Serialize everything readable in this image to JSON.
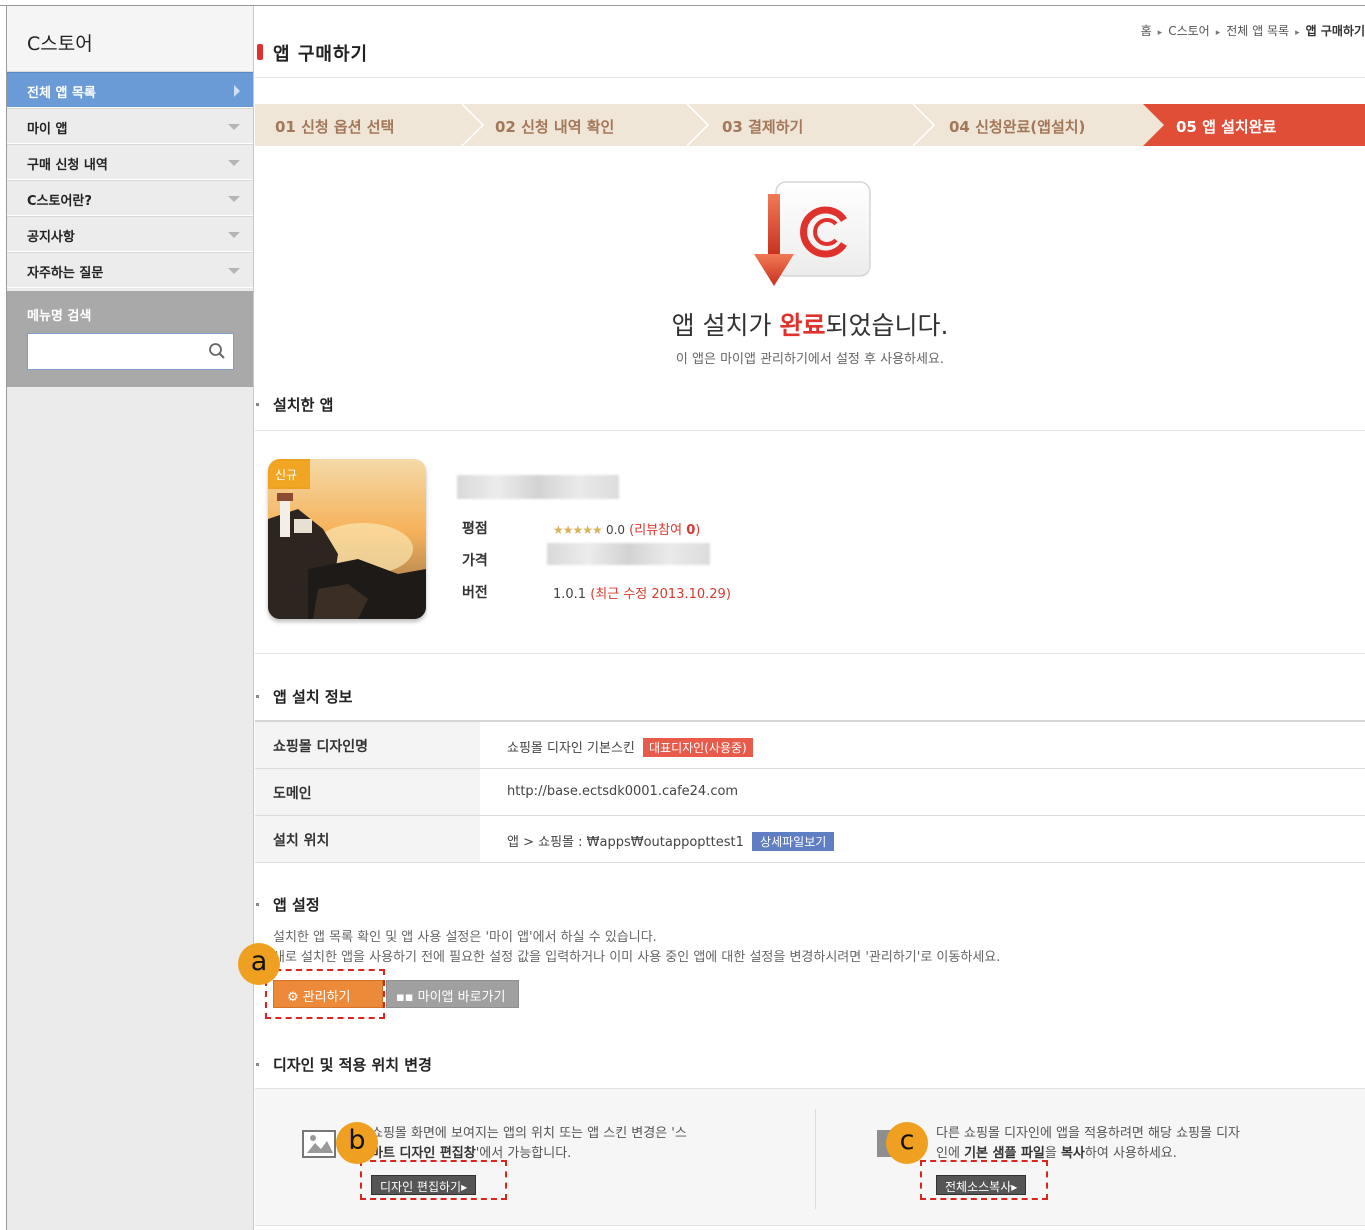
{
  "sidebar": {
    "title": "C스토어",
    "items": [
      {
        "label": "전체 앱 목록"
      },
      {
        "label": "마이 앱"
      },
      {
        "label": "구매 신청 내역"
      },
      {
        "label": "C스토어란?"
      },
      {
        "label": "공지사항"
      },
      {
        "label": "자주하는 질문"
      }
    ],
    "search_label": "메뉴명 검색",
    "search_value": ""
  },
  "header": {
    "title": "앱 구매하기",
    "breadcrumb": [
      "홈",
      "C스토어",
      "전체 앱 목록",
      "앱 구매하기"
    ]
  },
  "steps": [
    {
      "label": "01 신청 옵션 선택"
    },
    {
      "label": "02 신청 내역 확인"
    },
    {
      "label": "03 결제하기"
    },
    {
      "label": "04 신청완료(앱설치)"
    },
    {
      "label": "05 앱 설치완료"
    }
  ],
  "complete": {
    "title_pre": "앱 설치가 ",
    "title_hl": "완료",
    "title_post": "되었습니다.",
    "subtitle": "이 앱은 마이앱 관리하기에서 설정 후 사용하세요."
  },
  "installed_app": {
    "section_title": "설치한 앱",
    "new_badge": "신규",
    "rating_label": "평점",
    "stars": "★★★★★",
    "rating_value": "0.0",
    "review_text": "(리뷰참여 ",
    "review_count": "0",
    "review_close": ")",
    "price_label": "가격",
    "version_label": "버전",
    "version": "1.0.1",
    "updated": "(최근 수정 2013.10.29)"
  },
  "install_info": {
    "section_title": "앱 설치 정보",
    "rows": [
      {
        "label": "쇼핑몰 디자인명",
        "value": "쇼핑몰 디자인 기본스킨",
        "tag": "대표디자인(사용중)"
      },
      {
        "label": "도메인",
        "value": "http://base.ectsdk0001.cafe24.com"
      },
      {
        "label": "설치 위치",
        "value": "앱 > 쇼핑몰 :  ₩apps₩outappopttest1",
        "tag": "상세파일보기"
      }
    ]
  },
  "app_settings": {
    "section_title": "앱 설정",
    "desc1": "설치한 앱 목록 확인 및 앱 사용 설정은 '마이 앱'에서 하실 수 있습니다.",
    "desc2": "새로 설치한 앱을 사용하기 전에 필요한 설정 값을 입력하거나 이미 사용 중인 앱에 대한 설정을 변경하시려면 '관리하기'로 이동하세요.",
    "manage_button": "관리하기",
    "myapp_button": "마이앱 바로가기"
  },
  "design_change": {
    "section_title": "디자인 및 적용 위치 변경",
    "left_text1": "쇼핑몰 화면에 보여지는 앱의 위치 또는 앱 스킨 변경은 '스",
    "left_text2_bold": "마트 디자인 편집창",
    "left_text2_rest": "'에서 가능합니다.",
    "left_button": "디자인 편집하기▸",
    "right_text1": "다른 쇼핑몰 디자인에 앱을 적용하려면 해당 쇼핑몰 디자",
    "right_text2_pre": "인에 ",
    "right_text2_bold": "기본 샘플 파일",
    "right_text2_mid": "을 ",
    "right_text2_bold2": "복사",
    "right_text2_rest": "하여 사용하세요.",
    "right_button": "전체소스복사▸"
  },
  "annotations": [
    "a",
    "b",
    "c"
  ],
  "colors": {
    "accent_red": "#e0322c",
    "active_blue": "#6b9bd6",
    "orange": "#ed8a3a",
    "badge": "#f0a021"
  }
}
